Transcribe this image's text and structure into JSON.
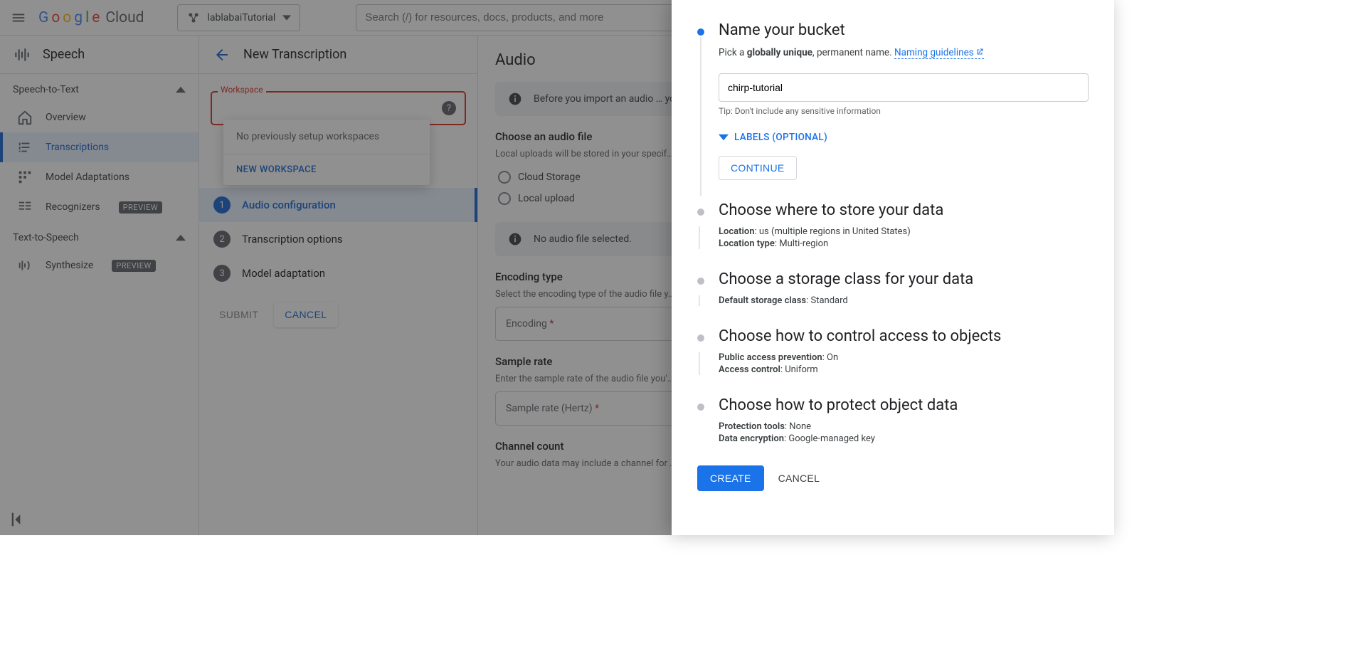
{
  "header": {
    "project_name": "lablabaiTutorial",
    "search_placeholder": "Search (/) for resources, docs, products, and more",
    "logo_cloud_word": "Cloud"
  },
  "sidebar": {
    "product_title": "Speech",
    "section1": "Speech-to-Text",
    "section2": "Text-to-Speech",
    "items": {
      "overview": "Overview",
      "transcriptions": "Transcriptions",
      "model_adaptations": "Model Adaptations",
      "recognizers": "Recognizers",
      "synthesize": "Synthesize"
    },
    "preview_chip": "PREVIEW"
  },
  "wizard": {
    "title": "New Transcription",
    "workspace_label": "Workspace",
    "workspace_empty": "No previously setup workspaces",
    "workspace_new": "NEW WORKSPACE",
    "step1": "Audio configuration",
    "step2": "Transcription options",
    "step3": "Model adaptation",
    "submit": "SUBMIT",
    "cancel": "CANCEL"
  },
  "audio": {
    "heading": "Audio",
    "header_note": "Before you import an audio … your speech data is optimiz…",
    "choose_file": "Choose an audio file",
    "local_note": "Local uploads will be stored in your specif…",
    "radio_cloud": "Cloud Storage",
    "radio_local": "Local upload",
    "no_file": "No audio file selected.",
    "encoding_heading": "Encoding type",
    "encoding_help": "Select the encoding type of the audio file y…",
    "encoding_placeholder": "Encoding",
    "sample_heading": "Sample rate",
    "sample_help": "Enter the sample rate of the audio file you'…",
    "sample_placeholder": "Sample rate (Hertz)",
    "channel_heading": "Channel count",
    "channel_help": "Your audio data may include a channel for …"
  },
  "drawer": {
    "s1_title": "Name your bucket",
    "s1_pick_a": "Pick a ",
    "s1_unique": "globally unique",
    "s1_rest": ", permanent name. ",
    "s1_link": "Naming guidelines",
    "bucket_value": "chirp-tutorial",
    "tip": "Tip: Don't include any sensitive information",
    "labels_toggle": "LABELS (OPTIONAL)",
    "continue": "CONTINUE",
    "s2_title": "Choose where to store your data",
    "s2_loc": "us (multiple regions in United States)",
    "s2_loc_type": "Multi-region",
    "s3_title": "Choose a storage class for your data",
    "s3_default": "Standard",
    "s4_title": "Choose how to control access to objects",
    "s4_prevention": "On",
    "s4_access": "Uniform",
    "s5_title": "Choose how to protect object data",
    "s5_tools": "None",
    "s5_encryption": "Google-managed key",
    "create": "CREATE",
    "cancel": "CANCEL",
    "labels": {
      "location": "Location",
      "location_type": "Location type",
      "default_storage_class": "Default storage class",
      "public_access_prevention": "Public access prevention",
      "access_control": "Access control",
      "protection_tools": "Protection tools",
      "data_encryption": "Data encryption"
    }
  }
}
